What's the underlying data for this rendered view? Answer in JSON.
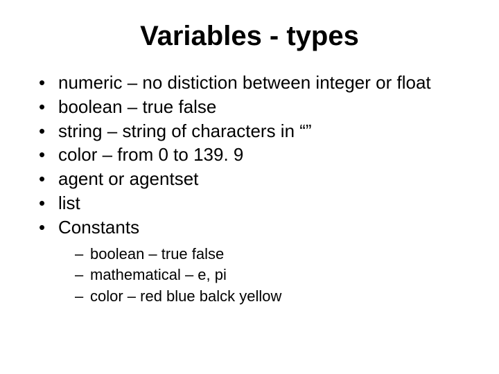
{
  "title": "Variables - types",
  "bullets": [
    "numeric – no distiction between integer or float",
    "boolean – true false",
    "string – string of characters in “”",
    "color – from 0 to 139. 9",
    "agent or agentset",
    "list",
    "Constants"
  ],
  "sub_bullets": [
    "boolean – true false",
    "mathematical – e, pi",
    "color – red blue balck yellow"
  ]
}
